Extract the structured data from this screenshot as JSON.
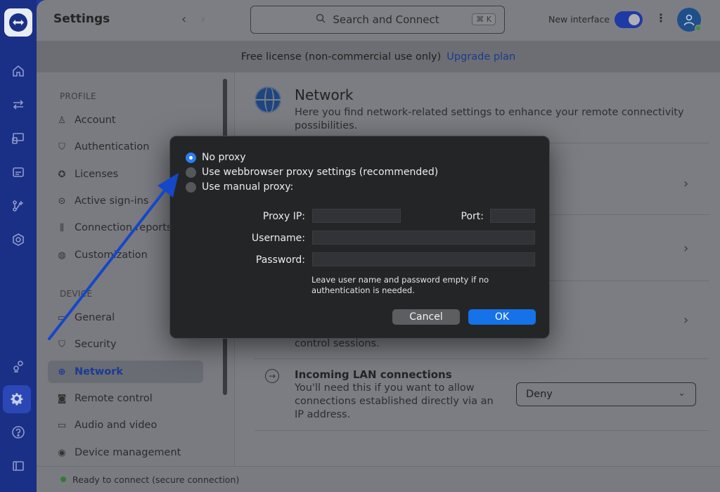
{
  "header": {
    "title": "Settings",
    "back_arrow": "‹",
    "forward_arrow": "›",
    "search_placeholder": "Search and Connect",
    "search_shortcut": "⌘ K",
    "new_interface_label": "New interface",
    "new_interface_enabled": true,
    "more_menu": "⋮"
  },
  "banner": {
    "text": "Free license (non-commercial use only)",
    "link": "Upgrade plan"
  },
  "sidebar": {
    "profile_section": "PROFILE",
    "device_section": "DEVICE",
    "profile_items": [
      {
        "label": "Account",
        "icon": "user-icon"
      },
      {
        "label": "Authentication",
        "icon": "shield-icon"
      },
      {
        "label": "Licenses",
        "icon": "badge-check-icon"
      },
      {
        "label": "Active sign-ins",
        "icon": "sign-in-icon"
      },
      {
        "label": "Connection reports",
        "icon": "bar-chart-icon"
      },
      {
        "label": "Customization",
        "icon": "palette-icon"
      }
    ],
    "device_items": [
      {
        "label": "General",
        "icon": "monitor-icon"
      },
      {
        "label": "Security",
        "icon": "shield-icon"
      },
      {
        "label": "Network",
        "icon": "globe-icon",
        "active": true
      },
      {
        "label": "Remote control",
        "icon": "remote-icon"
      },
      {
        "label": "Audio and video",
        "icon": "video-icon"
      },
      {
        "label": "Device management",
        "icon": "device-gear-icon"
      }
    ]
  },
  "main": {
    "title": "Network",
    "description": "Here you find network-related settings to enhance your remote connectivity possibilities.",
    "partial_row_text": "control sessions.",
    "lan": {
      "title": "Incoming LAN connections",
      "description": "You'll need this if you want to allow connections established directly via an IP address.",
      "value": "Deny"
    }
  },
  "status_bar": {
    "text": "Ready to connect (secure connection)",
    "color": "#2e7d32"
  },
  "proxy_dialog": {
    "options": [
      {
        "label": "No proxy",
        "selected": true
      },
      {
        "label": "Use webbrowser proxy settings (recommended)",
        "selected": false
      },
      {
        "label": "Use manual proxy:",
        "selected": false
      }
    ],
    "proxy_ip_label": "Proxy IP:",
    "port_label": "Port:",
    "username_label": "Username:",
    "password_label": "Password:",
    "proxy_ip_value": "",
    "port_value": "",
    "username_value": "",
    "password_value": "",
    "hint": "Leave user name and password empty if no authentication is needed.",
    "cancel_label": "Cancel",
    "ok_label": "OK"
  },
  "colors": {
    "rail": "#1a2f86",
    "accent": "#1572e8",
    "annotation_arrow": "#1547c9"
  }
}
